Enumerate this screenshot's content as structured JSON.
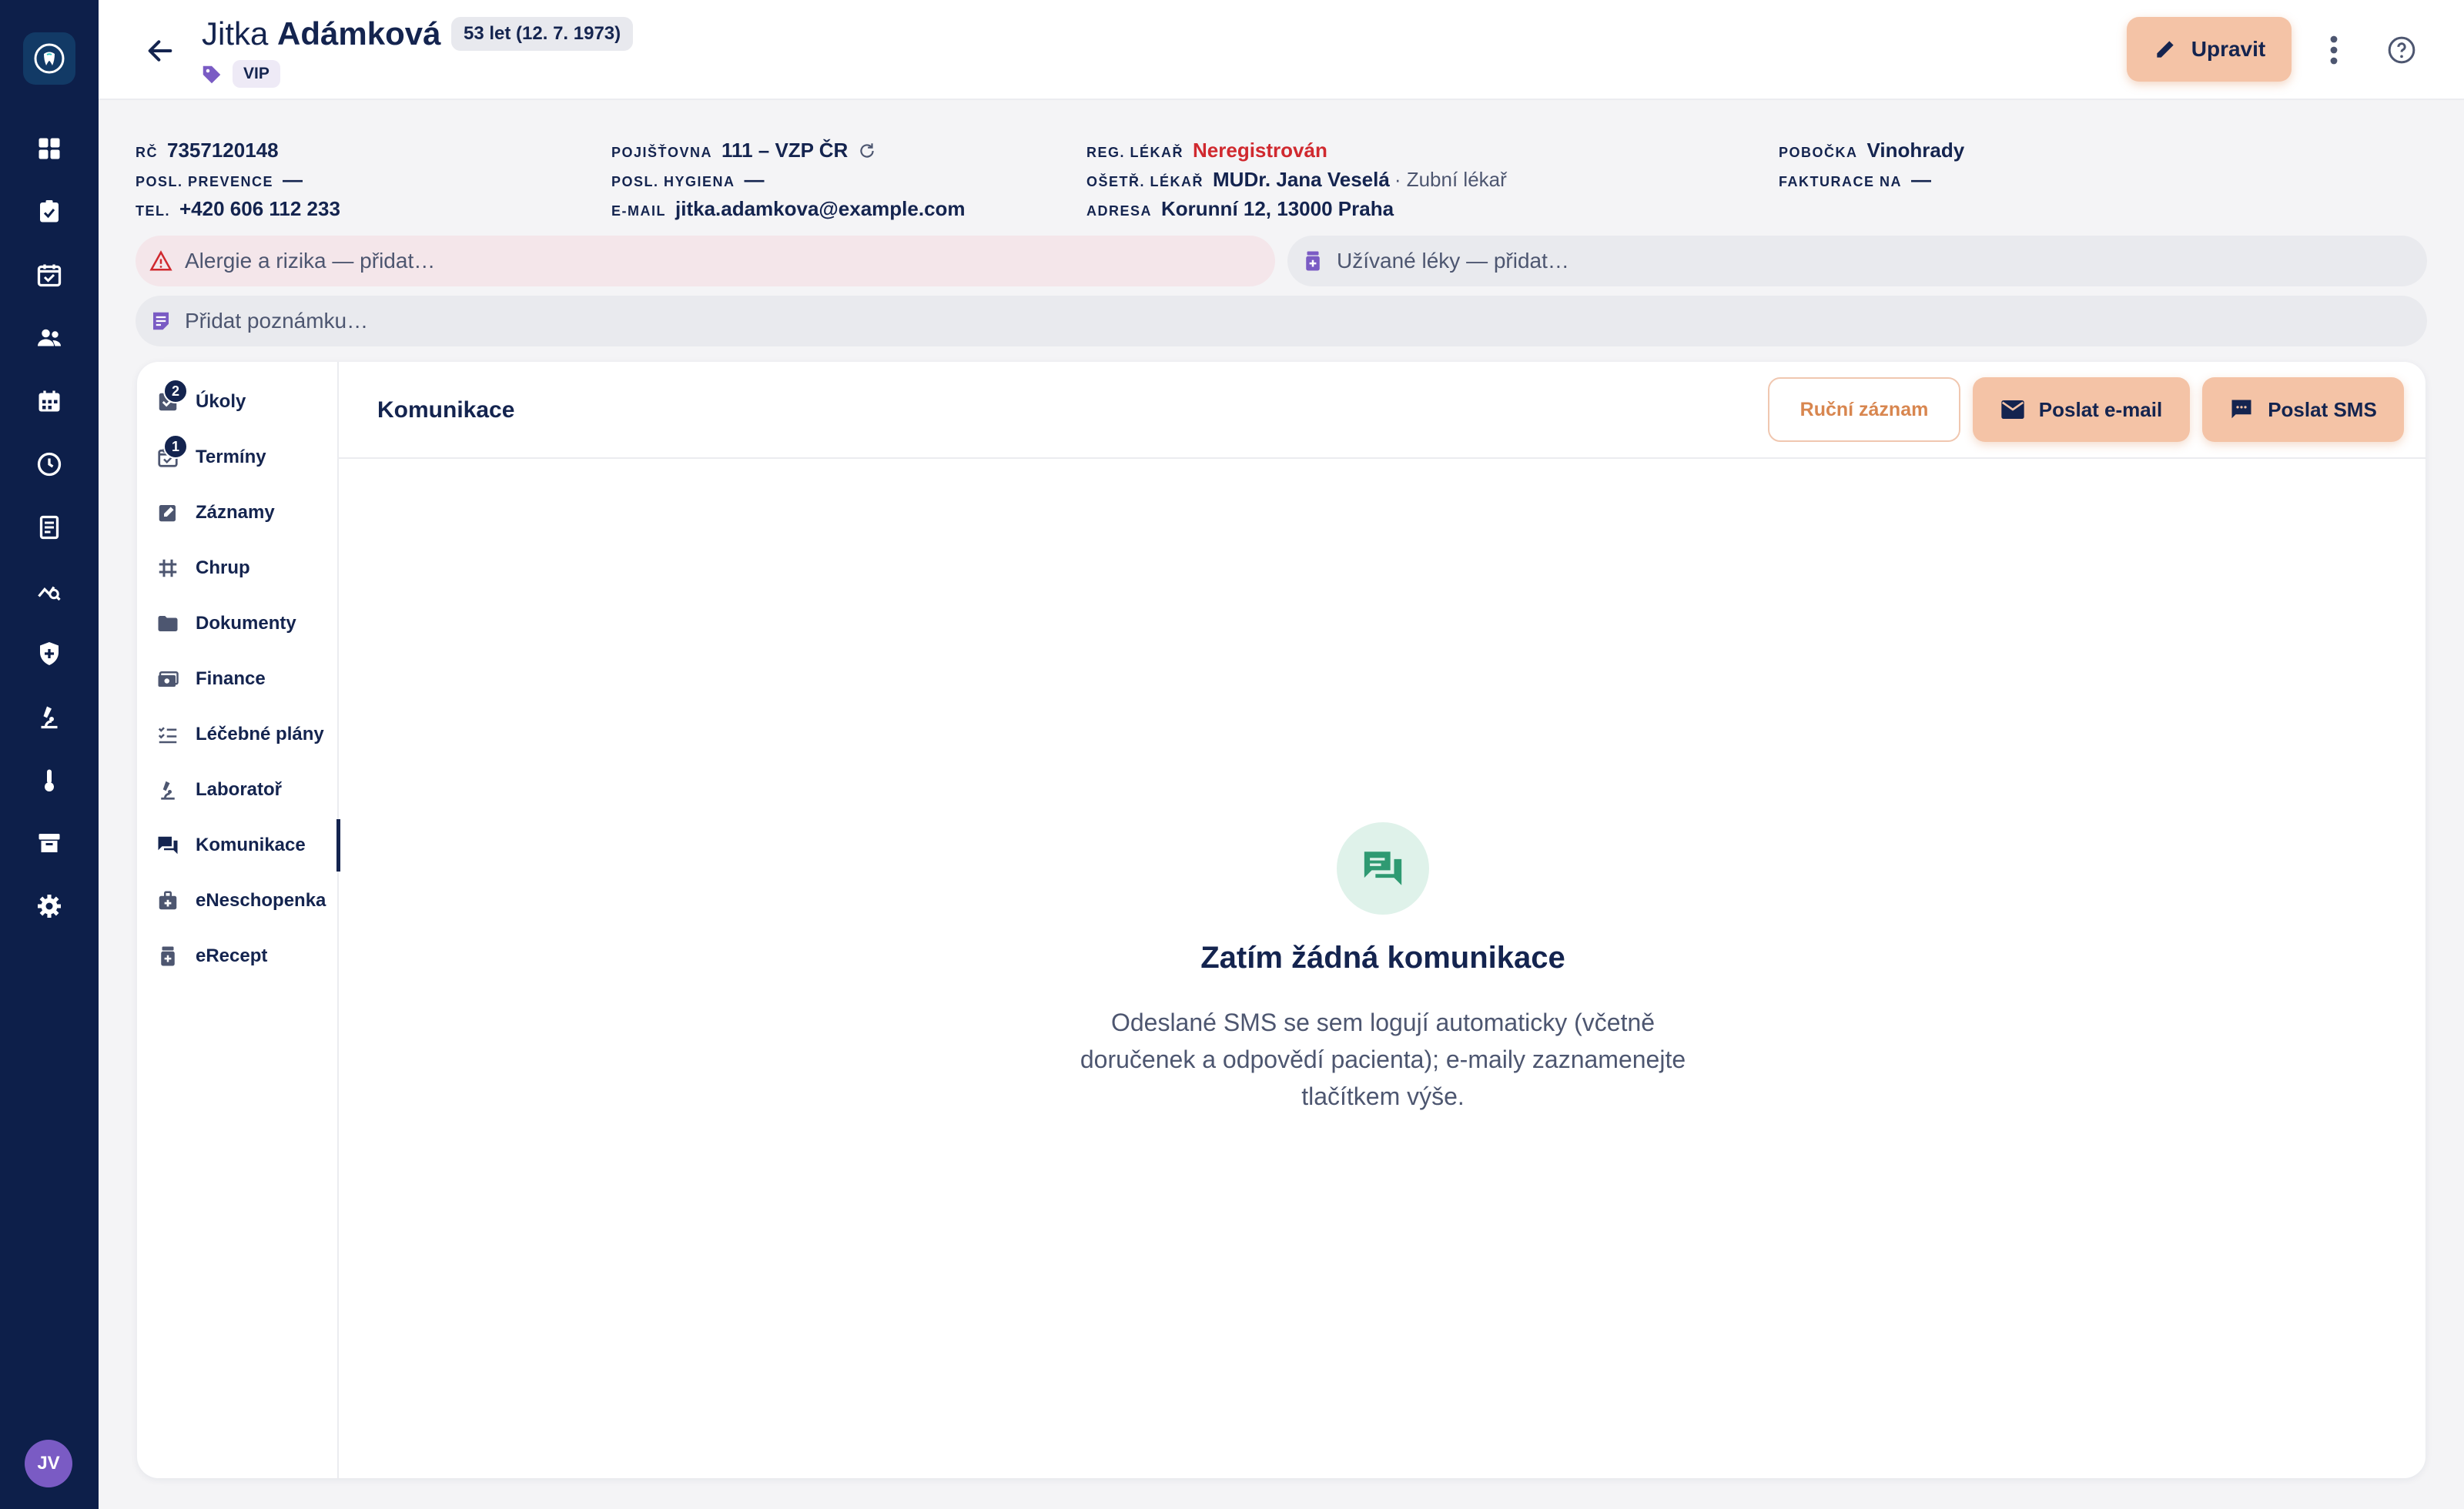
{
  "colors": {
    "rail_bg": "#0d1f4a",
    "accent": "#f4c3a6",
    "accent_text": "#d8864f",
    "danger": "#d0292f",
    "empty_icon_bg": "#dff2ea",
    "empty_icon": "#2f9a72"
  },
  "rail": {
    "logo_icon": "tooth-logo-icon",
    "items": [
      {
        "icon": "dashboard-icon"
      },
      {
        "icon": "tasks-icon"
      },
      {
        "icon": "calendar-check-icon"
      },
      {
        "icon": "patients-icon"
      },
      {
        "icon": "calendar-icon"
      },
      {
        "icon": "clock-icon"
      },
      {
        "icon": "documents-icon"
      },
      {
        "icon": "analytics-icon"
      },
      {
        "icon": "shield-icon"
      },
      {
        "icon": "microscope-icon"
      },
      {
        "icon": "thermometer-icon"
      },
      {
        "icon": "archive-icon"
      },
      {
        "icon": "settings-icon"
      }
    ],
    "avatar_initials": "JV"
  },
  "header": {
    "first_name": "Jitka",
    "last_name": "Adámková",
    "age": "53 let (12. 7. 1973)",
    "tag": "VIP",
    "edit_label": "Upravit"
  },
  "info": {
    "rc_label": "RČ",
    "rc": "7357120148",
    "prevence_label": "POSL. PREVENCE",
    "prevence": "—",
    "tel_label": "TEL.",
    "tel": "+420 606 112 233",
    "pojistovna_label": "POJIŠŤOVNA",
    "pojistovna": "111 – VZP ČR",
    "hygiena_label": "POSL. HYGIENA",
    "hygiena": "—",
    "email_label": "E-MAIL",
    "email": "jitka.adamkova@example.com",
    "reg_lekar_label": "REG. LÉKAŘ",
    "reg_lekar": "Neregistrován",
    "oset_lekar_label": "OŠETŘ. LÉKAŘ",
    "oset_lekar": "MUDr. Jana Veselá",
    "oset_role": "· Zubní lékař",
    "adresa_label": "ADRESA",
    "adresa": "Korunní 12, 13000 Praha",
    "pobocka_label": "POBOČKA",
    "pobocka": "Vinohrady",
    "fakturace_label": "FAKTURACE NA",
    "fakturace": "—"
  },
  "quick": {
    "alergie": "Alergie a rizika — přidat…",
    "leky": "Užívané léky — přidat…",
    "poznamka": "Přidat poznámku…"
  },
  "subnav": [
    {
      "label": "Úkoly",
      "icon": "task-check-icon",
      "badge": "2"
    },
    {
      "label": "Termíny",
      "icon": "calendar-check-icon",
      "badge": "1"
    },
    {
      "label": "Záznamy",
      "icon": "edit-note-icon",
      "badge": ""
    },
    {
      "label": "Chrup",
      "icon": "grid-icon",
      "badge": ""
    },
    {
      "label": "Dokumenty",
      "icon": "folder-icon",
      "badge": ""
    },
    {
      "label": "Finance",
      "icon": "money-icon",
      "badge": ""
    },
    {
      "label": "Léčebné plány",
      "icon": "checklist-icon",
      "badge": ""
    },
    {
      "label": "Laboratoř",
      "icon": "microscope-icon",
      "badge": ""
    },
    {
      "label": "Komunikace",
      "icon": "chat-icon",
      "badge": "",
      "active": true
    },
    {
      "label": "eNeschopenka",
      "icon": "medical-bag-icon",
      "badge": ""
    },
    {
      "label": "eRecept",
      "icon": "medication-icon",
      "badge": ""
    }
  ],
  "content": {
    "title": "Komunikace",
    "manual_label": "Ruční záznam",
    "email_label": "Poslat e-mail",
    "sms_label": "Poslat SMS",
    "empty_title": "Zatím žádná komunikace",
    "empty_text": "Odeslané SMS se sem logují automaticky (včetně doručenek a odpovědí pacienta); e-maily zaznamenejte tlačítkem výše."
  }
}
